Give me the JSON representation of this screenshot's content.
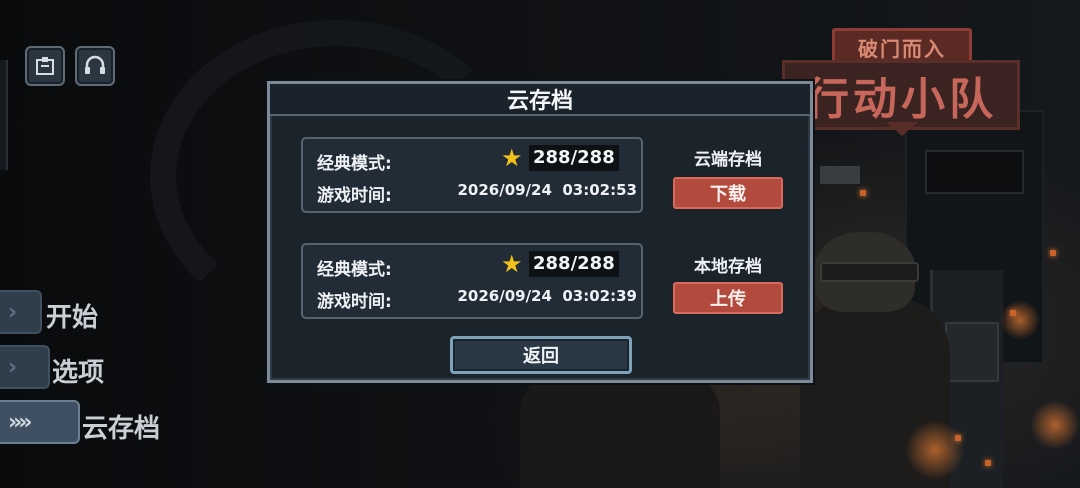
{
  "logo": {
    "subtitle": "破门而入",
    "title": "行动小队"
  },
  "top_icons": [
    {
      "icon": "clipboard-icon"
    },
    {
      "icon": "headset-icon"
    }
  ],
  "menu": {
    "items": [
      {
        "label": "开始",
        "active": false
      },
      {
        "label": "选项",
        "active": false
      },
      {
        "label": "云存档",
        "active": true
      }
    ]
  },
  "dialog": {
    "title": "云存档",
    "cloud_save": {
      "mode_label": "经典模式:",
      "score": "288/288",
      "time_label": "游戏时间:",
      "time": "2026/09/24  03:02:53",
      "side_title": "云端存档",
      "action": "下载"
    },
    "local_save": {
      "mode_label": "经典模式:",
      "score": "288/288",
      "time_label": "游戏时间:",
      "time": "2026/09/24  03:02:39",
      "side_title": "本地存档",
      "action": "上传"
    },
    "back_label": "返回"
  },
  "colors": {
    "accent_red": "#b24a3d",
    "star": "#f2c21c",
    "dialog_bg": "#1b232b"
  }
}
